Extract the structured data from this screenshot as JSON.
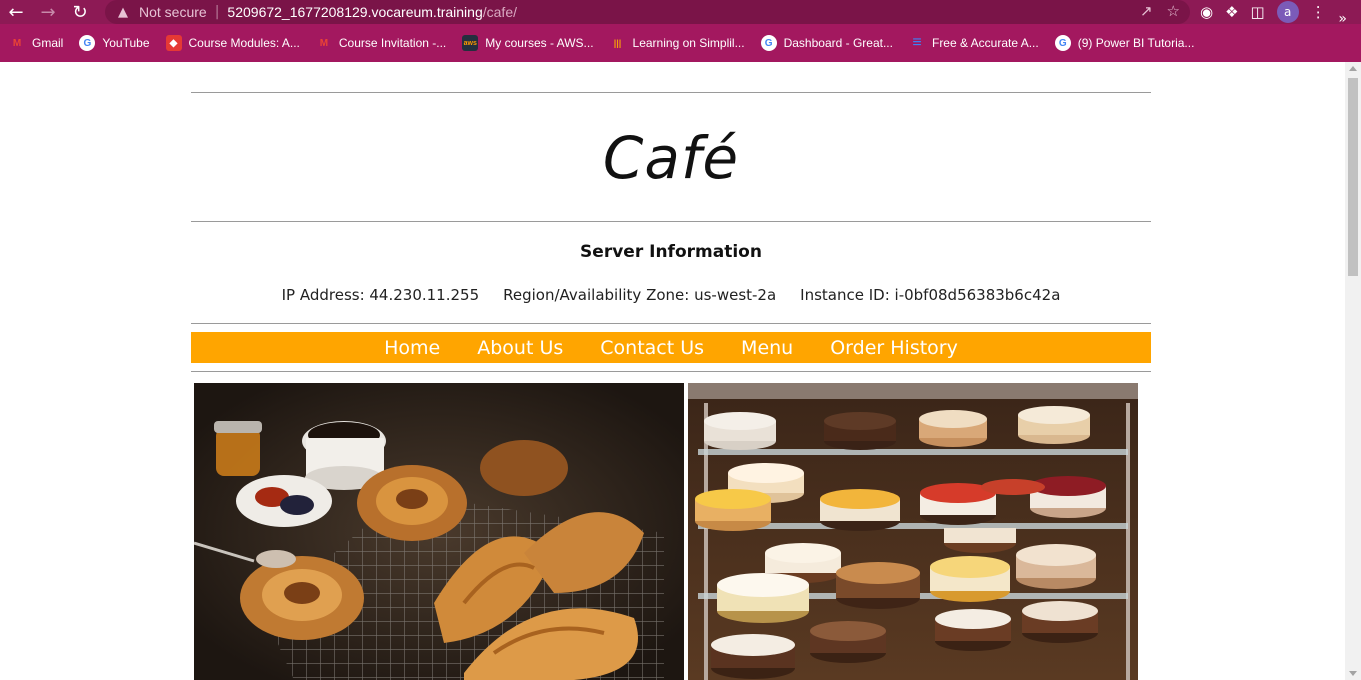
{
  "browser": {
    "insecure_label": "Not secure",
    "url_host": "5209672_1677208129.vocareum.training",
    "url_path": "/cafe/",
    "avatar_letter": "a"
  },
  "bookmarks": [
    {
      "label": "Gmail",
      "icon": "gmail-icon",
      "color": "#ea4335"
    },
    {
      "label": "YouTube",
      "icon": "google-icon",
      "color": "#ffffff"
    },
    {
      "label": "Course Modules: A...",
      "icon": "course-icon",
      "color": "#e53935"
    },
    {
      "label": "Course Invitation -...",
      "icon": "gmail-icon",
      "color": "#ea4335"
    },
    {
      "label": "My courses - AWS...",
      "icon": "aws-icon",
      "color": "#232f3e"
    },
    {
      "label": "Learning on Simplil...",
      "icon": "simplilearn-icon",
      "color": "#f59e0b"
    },
    {
      "label": "Dashboard - Great...",
      "icon": "google-icon",
      "color": "#ffffff"
    },
    {
      "label": "Free & Accurate A...",
      "icon": "doc-icon",
      "color": "#3b82f6"
    },
    {
      "label": "(9) Power BI Tutoria...",
      "icon": "google-icon",
      "color": "#ffffff"
    }
  ],
  "site": {
    "title": "Café",
    "server_heading": "Server Information",
    "ip": "IP Address: 44.230.11.255",
    "region": "Region/Availability Zone: us-west-2a",
    "instance": "Instance ID: i-0bf08d56383b6c42a"
  },
  "nav": [
    "Home",
    "About Us",
    "Contact Us",
    "Menu",
    "Order History"
  ],
  "colors": {
    "nav_bg": "#ffa500",
    "chrome_bg": "#8d1a55",
    "bookmarks_bg": "#a3185f"
  }
}
